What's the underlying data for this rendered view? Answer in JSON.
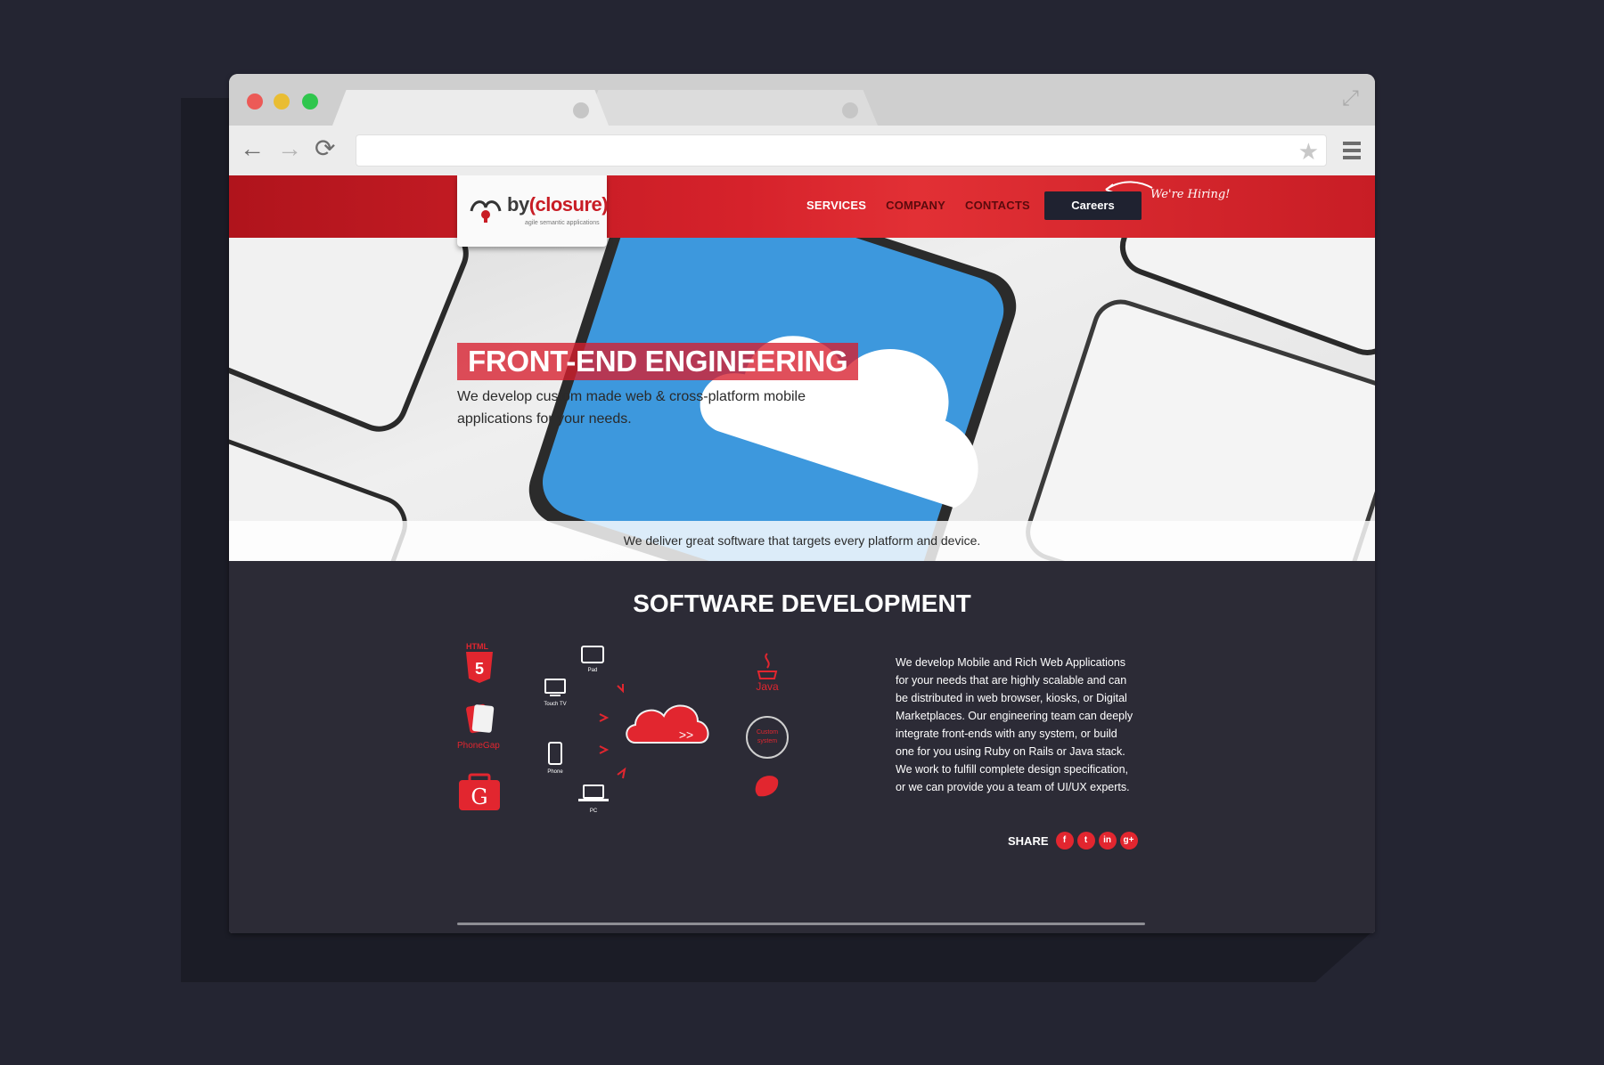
{
  "site": {
    "logo_text_prefix": "by",
    "logo_text_main": "(closure)",
    "logo_tagline": "agile semantic applications",
    "nav": [
      {
        "label": "SERVICES",
        "active": true
      },
      {
        "label": "COMPANY",
        "active": false
      },
      {
        "label": "CONTACTS",
        "active": false
      }
    ],
    "careers_label": "Careers",
    "hiring_note": "We're Hiring!"
  },
  "hero": {
    "title": "FRONT-END ENGINEERING",
    "subtitle": "We develop custom made web & cross-platform mobile applications for your needs.",
    "tagline": "We deliver great software that targets every platform and device."
  },
  "section": {
    "title": "SOFTWARE DEVELOPMENT",
    "description": "We develop Mobile and Rich Web Applications for your needs that are highly scalable and can be distributed in web browser, kiosks, or Digital Marketplaces. Our engineering team can deeply integrate front-ends with any system, or build one for you using Ruby on Rails or Java stack. We work to fulfill complete design specification, or we can provide you a team of UI/UX experts.",
    "diagram": {
      "left_tech": [
        {
          "icon": "html5-icon",
          "label": "HTML"
        },
        {
          "icon": "phonegap-icon",
          "label": "PhoneGap"
        },
        {
          "icon": "gwt-icon",
          "label": "G"
        }
      ],
      "devices": [
        {
          "icon": "tablet-icon",
          "label": "Pad"
        },
        {
          "icon": "tv-icon",
          "label": "Touch TV"
        },
        {
          "icon": "phone-icon",
          "label": "Phone"
        },
        {
          "icon": "laptop-icon",
          "label": "PC"
        }
      ],
      "right_tech": [
        {
          "icon": "java-icon",
          "label": "Java"
        },
        {
          "icon": "custom-system-icon",
          "label": "Custom system"
        },
        {
          "icon": "ruby-icon",
          "label": ""
        }
      ],
      "cloud_symbol": ">>"
    },
    "share_label": "SHARE",
    "social": [
      {
        "icon": "facebook-icon",
        "glyph": "f"
      },
      {
        "icon": "twitter-icon",
        "glyph": "t"
      },
      {
        "icon": "linkedin-icon",
        "glyph": "in"
      },
      {
        "icon": "googleplus-icon",
        "glyph": "g+"
      }
    ]
  },
  "colors": {
    "brand_red": "#d6222b",
    "page_bg": "#242532",
    "section_dark": "#2c2b36"
  }
}
